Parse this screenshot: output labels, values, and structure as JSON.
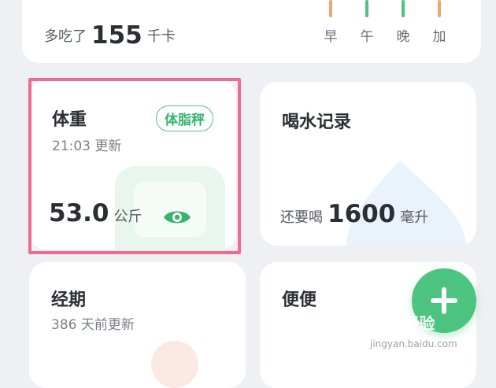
{
  "calorie": {
    "prefix": "多吃了",
    "value": "155",
    "unit": "千卡",
    "meals": [
      {
        "label": "早",
        "color": "#f0a46e"
      },
      {
        "label": "午",
        "color": "#4cc47f"
      },
      {
        "label": "晚",
        "color": "#4cc47f"
      },
      {
        "label": "加",
        "color": "#f0a46e"
      }
    ]
  },
  "weight": {
    "title": "体重",
    "updated": "21:03 更新",
    "tag": "体脂秤",
    "value": "53.0",
    "unit": "公斤",
    "eye_icon": "eye-icon"
  },
  "water": {
    "title": "喝水记录",
    "prefix": "还要喝",
    "value": "1600",
    "unit": "毫升"
  },
  "period": {
    "title": "经期",
    "updated": "386 天前更新"
  },
  "poop": {
    "title": "便便"
  },
  "fab": {
    "icon": "plus-icon",
    "color": "#4cc47f"
  },
  "watermark": {
    "text": "Bai 经验",
    "sub": "jingyan.baidu.com"
  }
}
